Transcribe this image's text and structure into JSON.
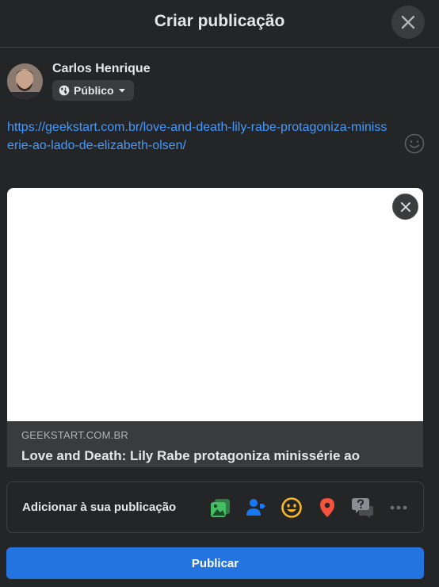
{
  "dialog": {
    "title": "Criar publicação"
  },
  "user": {
    "name": "Carlos Henrique",
    "audience": "Público"
  },
  "post": {
    "link_text": "https://geekstart.com.br/love-and-death-lily-rabe-protagoniza-minisserie-ao-lado-de-elizabeth-olsen/"
  },
  "preview": {
    "domain": "GEEKSTART.COM.BR",
    "title": "Love and Death: Lily Rabe protagoniza minissérie ao"
  },
  "add_to_post": {
    "label": "Adicionar à sua publicação",
    "icons": [
      "photo-video-icon",
      "tag-people-icon",
      "feeling-icon",
      "check-in-icon",
      "qa-icon",
      "more-icon"
    ]
  },
  "actions": {
    "publish_label": "Publicar"
  },
  "colors": {
    "background": "#242526",
    "link": "#4599ff",
    "primary_button": "#2374e1",
    "photo_icon": "#45bd62",
    "tag_icon": "#1877f2",
    "feeling_icon": "#f7b928",
    "location_icon": "#f5533d"
  }
}
